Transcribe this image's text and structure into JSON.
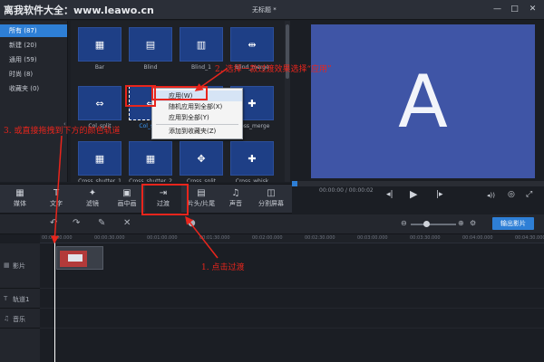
{
  "watermark": "离我软件大全：www.leawo.cn",
  "window": {
    "title": "无标题 *",
    "minimize": "—",
    "maximize": "□",
    "close": "✕"
  },
  "categories": [
    {
      "label": "所有 (87)",
      "active": true
    },
    {
      "label": "新建 (20)",
      "active": false
    },
    {
      "label": "通用 (59)",
      "active": false
    },
    {
      "label": "时尚 (8)",
      "active": false
    },
    {
      "label": "收藏夹 (0)",
      "active": false
    }
  ],
  "collapse_glyph": "‹",
  "transitions": [
    {
      "label": "Bar",
      "glyph": "▦"
    },
    {
      "label": "Blind",
      "glyph": "▤"
    },
    {
      "label": "Blind_1",
      "glyph": "▥"
    },
    {
      "label": "Blind_merge",
      "glyph": "⇹"
    },
    {
      "label": "Col_split",
      "glyph": "⇔"
    },
    {
      "label": "Col_split",
      "glyph": "⇔"
    },
    {
      "label": "",
      "glyph": "⇕"
    },
    {
      "label": "Cross_merge",
      "glyph": "✚"
    },
    {
      "label": "Cross_shutter_1",
      "glyph": "▦"
    },
    {
      "label": "Cross_shutter_2",
      "glyph": "▦"
    },
    {
      "label": "Cross_split",
      "glyph": "✥"
    },
    {
      "label": "Cross_whisk",
      "glyph": "✚"
    }
  ],
  "context_menu": {
    "items": [
      "应用(W)",
      "随机应用到全部(X)",
      "应用到全部(Y)",
      "添加到收藏夹(Z)"
    ]
  },
  "preview": {
    "letter": "A",
    "time": "00:00:00 / 00:00:02",
    "prev": "◂|",
    "play": "▶",
    "next": "|▸",
    "volume": "◂))",
    "snapshot": "◎",
    "fullscreen": "⤢"
  },
  "tools": [
    {
      "label": "媒体",
      "icon": "▦"
    },
    {
      "label": "文字",
      "icon": "T"
    },
    {
      "label": "滤镜",
      "icon": "✦"
    },
    {
      "label": "画中画",
      "icon": "▣"
    },
    {
      "label": "过渡",
      "icon": "⇥"
    },
    {
      "label": "片头/片尾",
      "icon": "▤"
    },
    {
      "label": "声音",
      "icon": "♫"
    },
    {
      "label": "分割屏幕",
      "icon": "◫"
    }
  ],
  "timeline": {
    "export_label": "输出影片",
    "ruler": [
      "00:00:00.000",
      "00:00:30.000",
      "00:01:00.000",
      "00:01:30.000",
      "00:02:00.000",
      "00:02:30.000",
      "00:03:00.000",
      "00:03:30.000",
      "00:04:00.000",
      "00:04:30.000"
    ],
    "tracks": [
      {
        "name": "影片",
        "icon": "▦"
      },
      {
        "name": "轨道1",
        "icon": "T"
      },
      {
        "name": "音乐",
        "icon": "♫"
      }
    ]
  },
  "annotations": {
    "step1": "1. 点击过渡",
    "step2": "2. 选择一款过渡效果选择“应用”",
    "step3": "3. 或直接拖拽到下方的颜色轨道"
  },
  "colors": {
    "accent": "#2e7fd6",
    "annotation": "#e8251c",
    "tile": "#1e3f86",
    "stage": "#3f55a6"
  }
}
